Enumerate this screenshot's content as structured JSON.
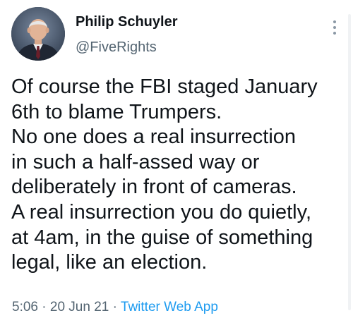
{
  "tweet": {
    "author": {
      "name": "Philip Schuyler",
      "handle": "@FiveRights"
    },
    "text_lines": [
      "Of course the FBI staged January",
      "6th to blame Trumpers.",
      "No one does a real insurrection",
      "in such a half-assed way or",
      "deliberately in front of cameras.",
      "A real insurrection you do quietly,",
      "at 4am, in the guise of something",
      "legal, like an election."
    ],
    "meta": {
      "time": "5:06",
      "separator": "·",
      "date": "20 Jun 21",
      "source": "Twitter Web App"
    }
  },
  "icons": {
    "more": "more-vertical-icon"
  },
  "colors": {
    "text": "#0f1419",
    "secondary": "#536471",
    "link": "#1d9bf0"
  }
}
